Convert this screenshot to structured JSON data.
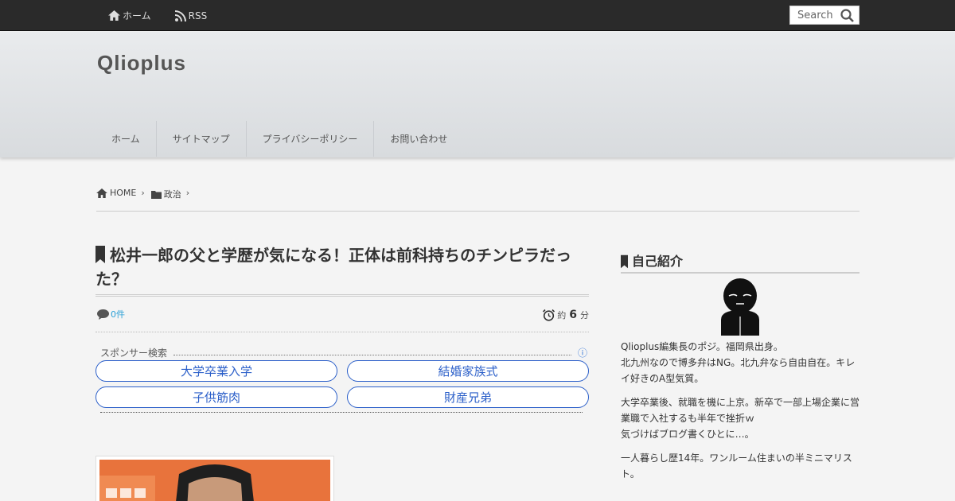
{
  "topbar": {
    "home_label": "ホーム",
    "rss_label": "RSS",
    "search_placeholder": "Search"
  },
  "header": {
    "site_title": "Qlioplus",
    "nav": [
      "ホーム",
      "サイトマップ",
      "プライバシーポリシー",
      "お問い合わせ"
    ]
  },
  "breadcrumb": {
    "home": "HOME",
    "category": "政治"
  },
  "article": {
    "title": "松井一郎の父と学歴が気になる！正体は前科持ちのチンピラだった？",
    "comments": "0件",
    "read_prefix": "約",
    "read_minutes": "6",
    "read_suffix": "分"
  },
  "sponsor": {
    "label": "スポンサー検索",
    "info_icon": "ⓘ",
    "links": [
      "大学卒業入学",
      "結婚家族式",
      "子供筋肉",
      "財産兄弟"
    ]
  },
  "sidebar": {
    "title": "自己紹介",
    "paragraphs": [
      "Qlioplus編集長のポジ。福岡県出身。\n北九州なので博多弁はNG。北九弁なら自由自在。キレイ好きのA型気質。",
      "大学卒業後、就職を機に上京。新卒で一部上場企業に営業職で入社するも半年で挫折ｗ\n気づけばブログ書くひとに…。",
      "一人暮らし歴14年。ワンルーム住まいの半ミニマリスト。"
    ]
  },
  "colors": {
    "topbar_bg": "#2a2a2a",
    "link_blue": "#2b5fc9",
    "comment_blue": "#2a9fd6"
  }
}
